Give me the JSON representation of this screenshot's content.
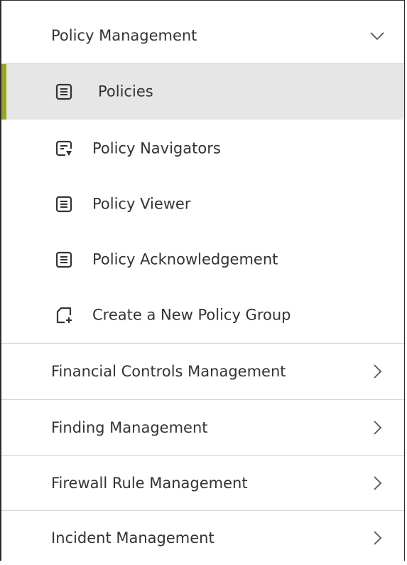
{
  "menu": {
    "sections": [
      {
        "label": "Policy Management",
        "expanded": true,
        "chevron": "chevron-down-icon",
        "items": [
          {
            "label": "Policies",
            "icon": "document-list-icon",
            "active": true
          },
          {
            "label": "Policy Navigators",
            "icon": "navigator-icon",
            "active": false
          },
          {
            "label": "Policy Viewer",
            "icon": "document-list-icon",
            "active": false
          },
          {
            "label": "Policy Acknowledgement",
            "icon": "document-list-icon",
            "active": false
          },
          {
            "label": "Create a New Policy Group",
            "icon": "new-page-icon",
            "active": false
          }
        ]
      },
      {
        "label": "Financial Controls Management",
        "expanded": false,
        "chevron": "chevron-right-icon"
      },
      {
        "label": "Finding Management",
        "expanded": false,
        "chevron": "chevron-right-icon"
      },
      {
        "label": "Firewall Rule Management",
        "expanded": false,
        "chevron": "chevron-right-icon"
      },
      {
        "label": "Incident Management",
        "expanded": false,
        "chevron": "chevron-right-icon"
      }
    ]
  },
  "colors": {
    "accent": "#9aa51e",
    "active_bg": "#e6e6e6",
    "text": "#333333",
    "divider": "#d6d6d6"
  }
}
